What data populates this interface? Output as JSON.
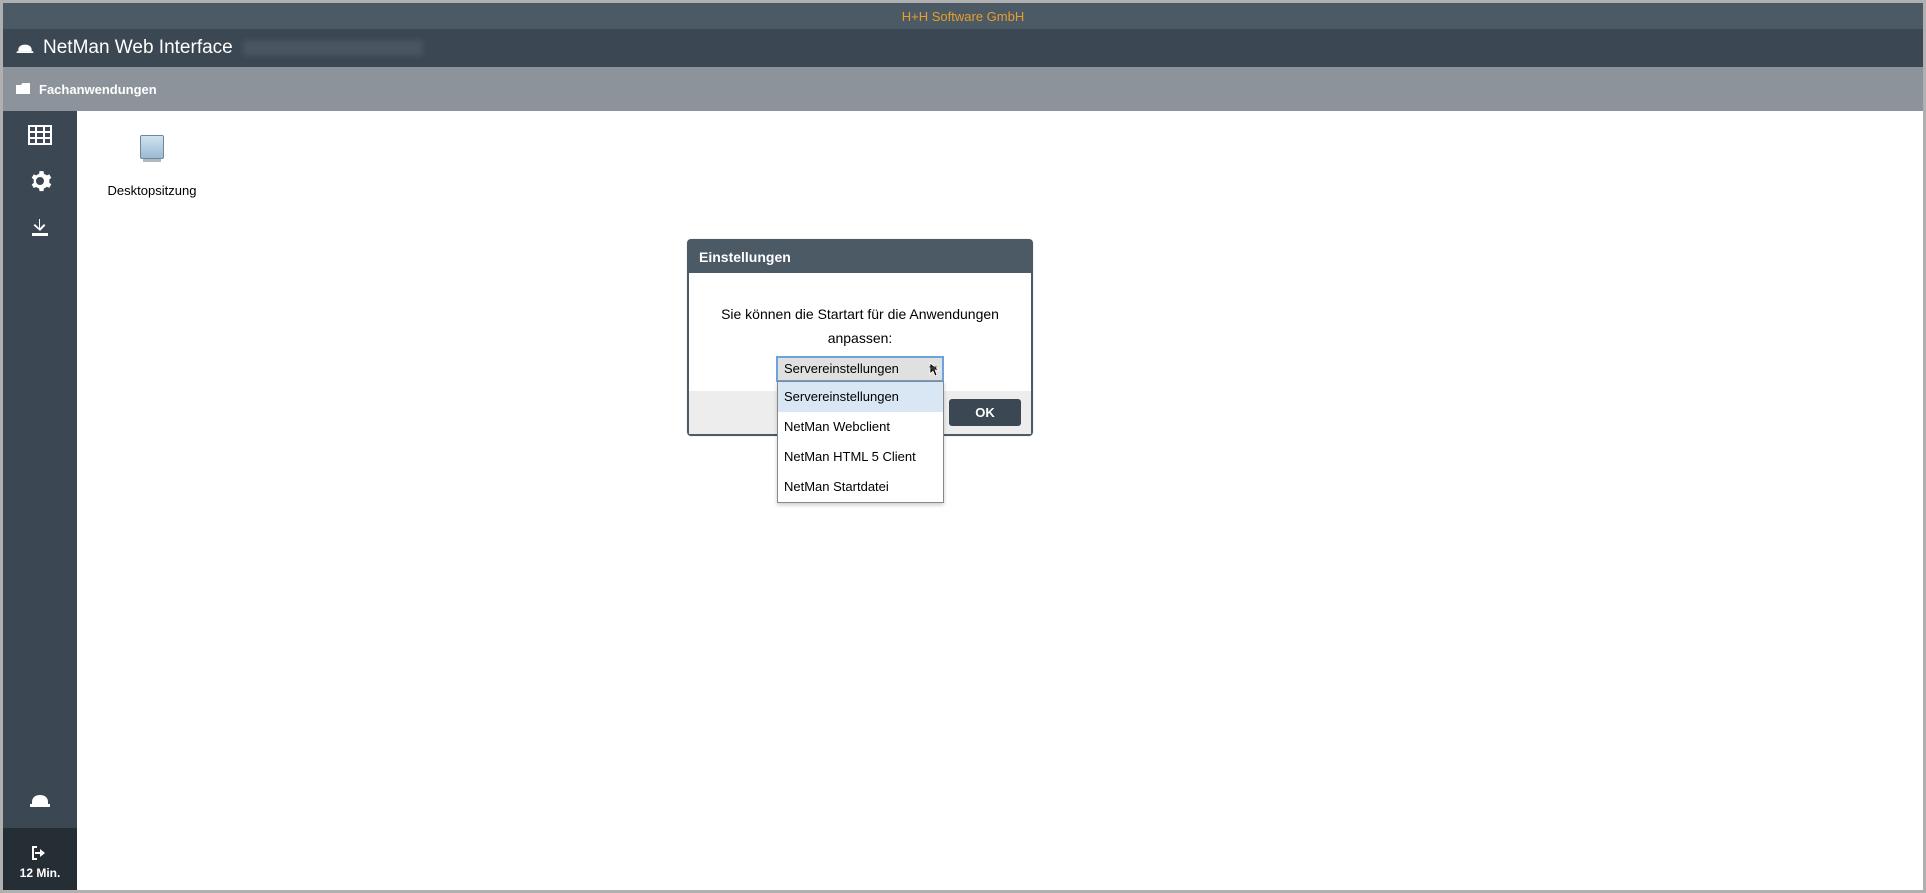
{
  "header": {
    "company": "H+H Software GmbH",
    "app_title": "NetMan Web Interface"
  },
  "breadcrumb": {
    "label": "Fachanwendungen"
  },
  "sidebar": {
    "logout_label": "12 Min."
  },
  "content": {
    "shortcuts": [
      {
        "label": "Desktopsitzung"
      }
    ]
  },
  "dialog": {
    "title": "Einstellungen",
    "message_line1": "Sie können die Startart für die Anwendungen",
    "message_line2": "anpassen:",
    "selected": "Servereinstellungen",
    "options": [
      "Servereinstellungen",
      "NetMan Webclient",
      "NetMan HTML 5 Client",
      "NetMan Startdatei"
    ],
    "ok_label": "OK"
  }
}
